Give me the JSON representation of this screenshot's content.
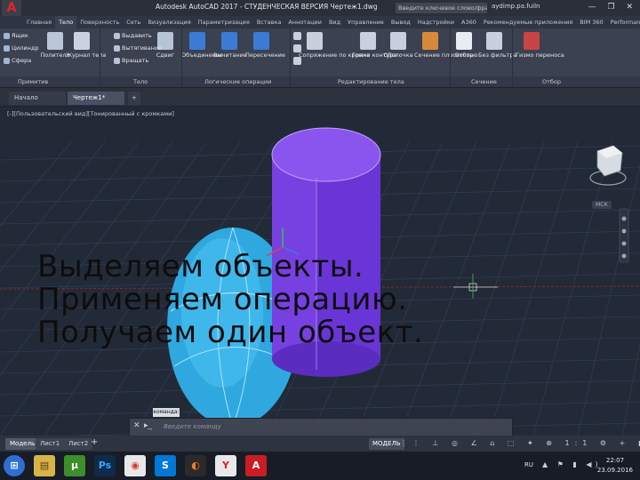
{
  "titlebar": {
    "app_letter": "A",
    "tabs": [
      "Главная",
      "Тело",
      "Поверхность",
      "Сеть",
      "Визуализация",
      "Параметризация",
      "Вставка",
      "Аннотации",
      "Вид",
      "Управление",
      "Вывод",
      "Надстройки",
      "A360",
      "Рекомендуемые приложения",
      "BIM 360",
      "Performance"
    ],
    "active_tab_index": 1,
    "title": "Autodesk AutoCAD 2017 - СТУДЕНЧЕСКАЯ ВЕРСИЯ   Чертеж1.dwg",
    "search_placeholder": "Введите ключевое слово/фразу",
    "user": "aydimp.pa.fuiln",
    "window_controls": "— ❐ ✕"
  },
  "ribbon": {
    "small_tools": [
      {
        "label": "Ящик",
        "color": "#9fb7d6"
      },
      {
        "label": "Цилиндр",
        "color": "#9fb7d6"
      },
      {
        "label": "Сфера",
        "color": "#9fb7d6"
      }
    ],
    "tools": [
      {
        "label": "Полителo",
        "color": "#b9c6d8"
      },
      {
        "label": "Журнал тела",
        "color": "#c9d2de"
      },
      {
        "label": "Сдвиг",
        "color": "#b7c4d6"
      },
      {
        "label": "Объединение",
        "color": "#3a7bd5"
      },
      {
        "label": "Вычитание",
        "color": "#3a7bd5"
      },
      {
        "label": "Пересечение",
        "color": "#3a7bd5"
      },
      {
        "label": "Сопряжение по кромке",
        "color": "#c7d0dc"
      },
      {
        "label": "Грани контура",
        "color": "#c7d0dc"
      },
      {
        "label": "Оболочка",
        "color": "#c7d0dc"
      },
      {
        "label": "Сечение плоскостью",
        "color": "#d68a3a"
      },
      {
        "label": "Отбор",
        "color": "#e8edf3"
      },
      {
        "label": "Без фильтра",
        "color": "#c7d0dc"
      },
      {
        "label": "Гизмо переноса",
        "color": "#c94444"
      }
    ],
    "stack_tools": [
      {
        "label": "Выдавить"
      },
      {
        "label": "Вытягивание"
      },
      {
        "label": "Вращать"
      }
    ],
    "panels": [
      "Примитив",
      "Тело",
      "Логические операции",
      "Редактирование тела",
      "Сечение",
      "Отбор"
    ]
  },
  "doctabs": {
    "tabs": [
      "Начало",
      "Чертеж1*"
    ],
    "active_index": 1,
    "add": "+"
  },
  "viewport": {
    "label": "[-][Пользовательский вид][Тонированный с кромками]",
    "viewcube_label": "МСК"
  },
  "overlay_text": [
    "Выделяем объекты.",
    "Применяем операцию.",
    "Получаем один объект."
  ],
  "cmdline": {
    "head": "команда:",
    "close": "✕",
    "placeholder": "Введите команду"
  },
  "layout_tabs": {
    "tabs": [
      "Модель",
      "Лист1",
      "Лист2"
    ],
    "active_index": 0,
    "add": "+"
  },
  "statusbar": {
    "model_label": "МОДЕЛЬ",
    "icons": "⋮⋮ ⊥ ◎ ∠ ⌂ ⬚ ✦ ⊕ 1:1 ⚙ + ◧ ≡"
  },
  "taskbar": {
    "apps": [
      {
        "name": "start",
        "glyph": "⊞",
        "color": "#2f6fd1",
        "text_color": "#ffffff"
      },
      {
        "name": "explorer",
        "glyph": "▤",
        "color": "#d8b34a",
        "text_color": "#5a3d0c"
      },
      {
        "name": "utorrent",
        "glyph": "µ",
        "color": "#3c8f2a",
        "text_color": "#ffffff"
      },
      {
        "name": "photoshop",
        "glyph": "Ps",
        "color": "#0f2a4a",
        "text_color": "#31a8ff"
      },
      {
        "name": "chrome",
        "glyph": "◉",
        "color": "#e8e8e8",
        "text_color": "#d33b2c"
      },
      {
        "name": "skype",
        "glyph": "S",
        "color": "#0078d7",
        "text_color": "#ffffff"
      },
      {
        "name": "blender",
        "glyph": "◐",
        "color": "#2a2a2a",
        "text_color": "#f5792a"
      },
      {
        "name": "yandex",
        "glyph": "Y",
        "color": "#e8e8e8",
        "text_color": "#e02020"
      },
      {
        "name": "autocad",
        "glyph": "A",
        "color": "#c81e24",
        "text_color": "#ffffff"
      }
    ],
    "lang": "RU",
    "tray": "▲ ⚑ ▮ ◀)",
    "time": "22:07",
    "date": "23.09.2016"
  },
  "colors": {
    "sphere": "#2fa8e0",
    "cylinder": "#7a3fe0",
    "grid": "#33405a",
    "accent_red": "#e4232b"
  }
}
